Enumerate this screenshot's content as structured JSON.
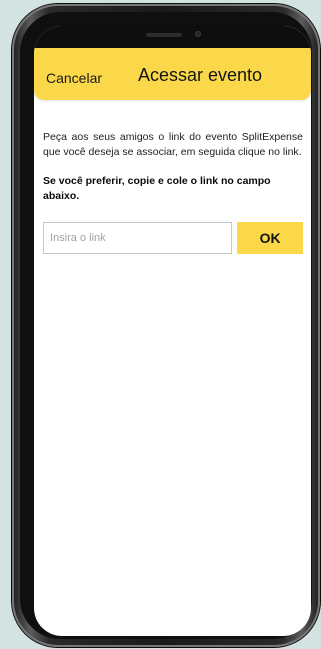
{
  "header": {
    "cancel_label": "Cancelar",
    "title": "Acessar evento"
  },
  "main": {
    "description": "Peça aos seus amigos o link do evento SplitExpense que você deseja se associar, em seguida clique no link.",
    "hint": "Se você preferir, copie e cole o link no campo abaixo.",
    "link_input": {
      "value": "",
      "placeholder": "Insira o link"
    },
    "ok_label": "OK"
  },
  "colors": {
    "accent": "#fbd84a",
    "background": "#d3e3e2"
  }
}
